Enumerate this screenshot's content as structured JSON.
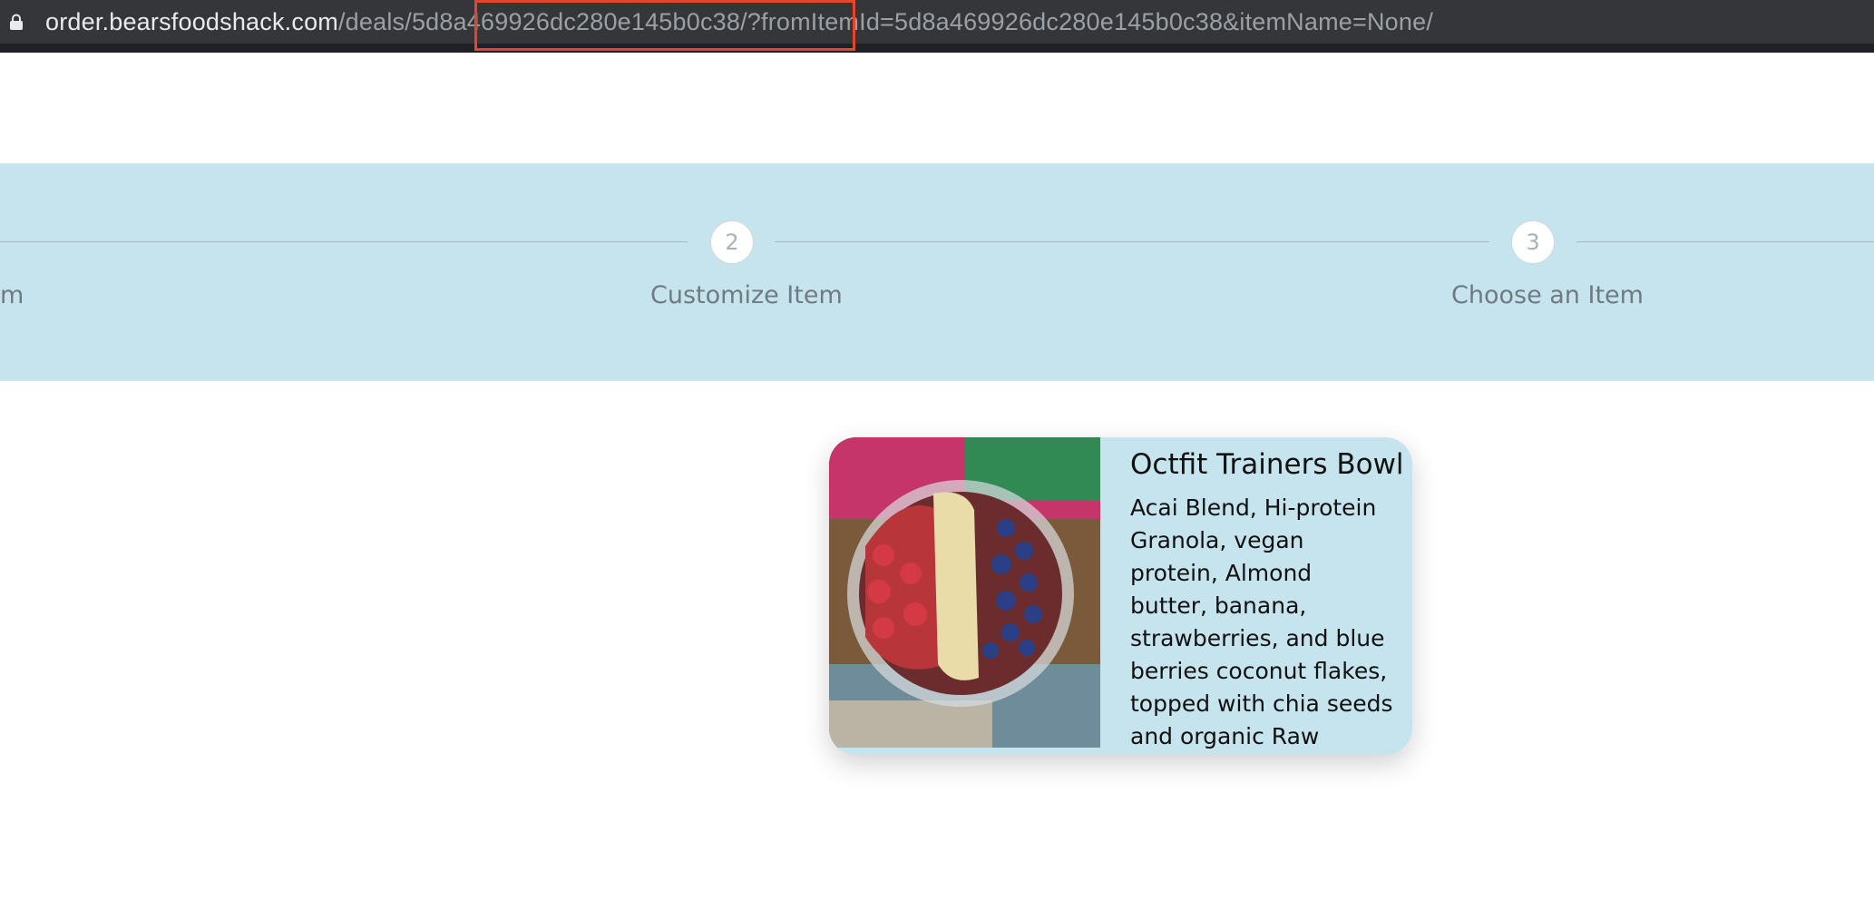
{
  "browser": {
    "url_host": "order.bearsfoodshack.com",
    "url_path_prefix": "/deals/",
    "url_highlighted": "5d8a469926dc280e145b0c38",
    "url_query": "/?fromItemId=5d8a469926dc280e145b0c38&itemName=None/",
    "highlight_color": "#e8432c",
    "icon": "lock-icon"
  },
  "steps": {
    "step1_label_fragment": "m",
    "step2_number": "2",
    "step2_label": "Customize Item",
    "step3_number": "3",
    "step3_label": "Choose an Item",
    "band_color": "#c6e4ee"
  },
  "card": {
    "title": "Octfit Trainers Bowl",
    "description": "Acai Blend, Hi-protein Granola, vegan protein, Almond butter, banana, strawberries, and blue berries coconut flakes, topped with chia seeds and organic Raw Honey",
    "image": "acai-bowl-image"
  }
}
